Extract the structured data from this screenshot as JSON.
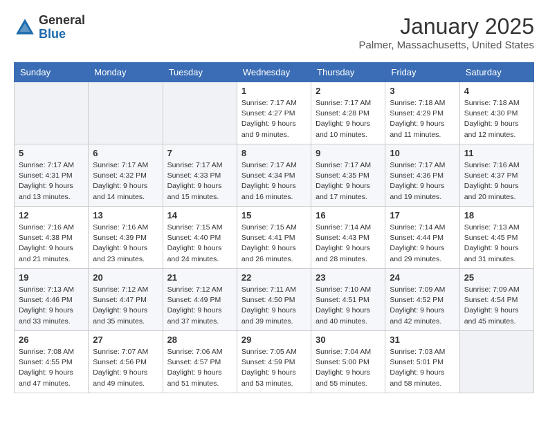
{
  "logo": {
    "general": "General",
    "blue": "Blue"
  },
  "header": {
    "title": "January 2025",
    "location": "Palmer, Massachusetts, United States"
  },
  "weekdays": [
    "Sunday",
    "Monday",
    "Tuesday",
    "Wednesday",
    "Thursday",
    "Friday",
    "Saturday"
  ],
  "weeks": [
    [
      {
        "day": "",
        "sunrise": "",
        "sunset": "",
        "daylight": ""
      },
      {
        "day": "",
        "sunrise": "",
        "sunset": "",
        "daylight": ""
      },
      {
        "day": "",
        "sunrise": "",
        "sunset": "",
        "daylight": ""
      },
      {
        "day": "1",
        "sunrise": "Sunrise: 7:17 AM",
        "sunset": "Sunset: 4:27 PM",
        "daylight": "Daylight: 9 hours and 9 minutes."
      },
      {
        "day": "2",
        "sunrise": "Sunrise: 7:17 AM",
        "sunset": "Sunset: 4:28 PM",
        "daylight": "Daylight: 9 hours and 10 minutes."
      },
      {
        "day": "3",
        "sunrise": "Sunrise: 7:18 AM",
        "sunset": "Sunset: 4:29 PM",
        "daylight": "Daylight: 9 hours and 11 minutes."
      },
      {
        "day": "4",
        "sunrise": "Sunrise: 7:18 AM",
        "sunset": "Sunset: 4:30 PM",
        "daylight": "Daylight: 9 hours and 12 minutes."
      }
    ],
    [
      {
        "day": "5",
        "sunrise": "Sunrise: 7:17 AM",
        "sunset": "Sunset: 4:31 PM",
        "daylight": "Daylight: 9 hours and 13 minutes."
      },
      {
        "day": "6",
        "sunrise": "Sunrise: 7:17 AM",
        "sunset": "Sunset: 4:32 PM",
        "daylight": "Daylight: 9 hours and 14 minutes."
      },
      {
        "day": "7",
        "sunrise": "Sunrise: 7:17 AM",
        "sunset": "Sunset: 4:33 PM",
        "daylight": "Daylight: 9 hours and 15 minutes."
      },
      {
        "day": "8",
        "sunrise": "Sunrise: 7:17 AM",
        "sunset": "Sunset: 4:34 PM",
        "daylight": "Daylight: 9 hours and 16 minutes."
      },
      {
        "day": "9",
        "sunrise": "Sunrise: 7:17 AM",
        "sunset": "Sunset: 4:35 PM",
        "daylight": "Daylight: 9 hours and 17 minutes."
      },
      {
        "day": "10",
        "sunrise": "Sunrise: 7:17 AM",
        "sunset": "Sunset: 4:36 PM",
        "daylight": "Daylight: 9 hours and 19 minutes."
      },
      {
        "day": "11",
        "sunrise": "Sunrise: 7:16 AM",
        "sunset": "Sunset: 4:37 PM",
        "daylight": "Daylight: 9 hours and 20 minutes."
      }
    ],
    [
      {
        "day": "12",
        "sunrise": "Sunrise: 7:16 AM",
        "sunset": "Sunset: 4:38 PM",
        "daylight": "Daylight: 9 hours and 21 minutes."
      },
      {
        "day": "13",
        "sunrise": "Sunrise: 7:16 AM",
        "sunset": "Sunset: 4:39 PM",
        "daylight": "Daylight: 9 hours and 23 minutes."
      },
      {
        "day": "14",
        "sunrise": "Sunrise: 7:15 AM",
        "sunset": "Sunset: 4:40 PM",
        "daylight": "Daylight: 9 hours and 24 minutes."
      },
      {
        "day": "15",
        "sunrise": "Sunrise: 7:15 AM",
        "sunset": "Sunset: 4:41 PM",
        "daylight": "Daylight: 9 hours and 26 minutes."
      },
      {
        "day": "16",
        "sunrise": "Sunrise: 7:14 AM",
        "sunset": "Sunset: 4:43 PM",
        "daylight": "Daylight: 9 hours and 28 minutes."
      },
      {
        "day": "17",
        "sunrise": "Sunrise: 7:14 AM",
        "sunset": "Sunset: 4:44 PM",
        "daylight": "Daylight: 9 hours and 29 minutes."
      },
      {
        "day": "18",
        "sunrise": "Sunrise: 7:13 AM",
        "sunset": "Sunset: 4:45 PM",
        "daylight": "Daylight: 9 hours and 31 minutes."
      }
    ],
    [
      {
        "day": "19",
        "sunrise": "Sunrise: 7:13 AM",
        "sunset": "Sunset: 4:46 PM",
        "daylight": "Daylight: 9 hours and 33 minutes."
      },
      {
        "day": "20",
        "sunrise": "Sunrise: 7:12 AM",
        "sunset": "Sunset: 4:47 PM",
        "daylight": "Daylight: 9 hours and 35 minutes."
      },
      {
        "day": "21",
        "sunrise": "Sunrise: 7:12 AM",
        "sunset": "Sunset: 4:49 PM",
        "daylight": "Daylight: 9 hours and 37 minutes."
      },
      {
        "day": "22",
        "sunrise": "Sunrise: 7:11 AM",
        "sunset": "Sunset: 4:50 PM",
        "daylight": "Daylight: 9 hours and 39 minutes."
      },
      {
        "day": "23",
        "sunrise": "Sunrise: 7:10 AM",
        "sunset": "Sunset: 4:51 PM",
        "daylight": "Daylight: 9 hours and 40 minutes."
      },
      {
        "day": "24",
        "sunrise": "Sunrise: 7:09 AM",
        "sunset": "Sunset: 4:52 PM",
        "daylight": "Daylight: 9 hours and 42 minutes."
      },
      {
        "day": "25",
        "sunrise": "Sunrise: 7:09 AM",
        "sunset": "Sunset: 4:54 PM",
        "daylight": "Daylight: 9 hours and 45 minutes."
      }
    ],
    [
      {
        "day": "26",
        "sunrise": "Sunrise: 7:08 AM",
        "sunset": "Sunset: 4:55 PM",
        "daylight": "Daylight: 9 hours and 47 minutes."
      },
      {
        "day": "27",
        "sunrise": "Sunrise: 7:07 AM",
        "sunset": "Sunset: 4:56 PM",
        "daylight": "Daylight: 9 hours and 49 minutes."
      },
      {
        "day": "28",
        "sunrise": "Sunrise: 7:06 AM",
        "sunset": "Sunset: 4:57 PM",
        "daylight": "Daylight: 9 hours and 51 minutes."
      },
      {
        "day": "29",
        "sunrise": "Sunrise: 7:05 AM",
        "sunset": "Sunset: 4:59 PM",
        "daylight": "Daylight: 9 hours and 53 minutes."
      },
      {
        "day": "30",
        "sunrise": "Sunrise: 7:04 AM",
        "sunset": "Sunset: 5:00 PM",
        "daylight": "Daylight: 9 hours and 55 minutes."
      },
      {
        "day": "31",
        "sunrise": "Sunrise: 7:03 AM",
        "sunset": "Sunset: 5:01 PM",
        "daylight": "Daylight: 9 hours and 58 minutes."
      },
      {
        "day": "",
        "sunrise": "",
        "sunset": "",
        "daylight": ""
      }
    ]
  ]
}
